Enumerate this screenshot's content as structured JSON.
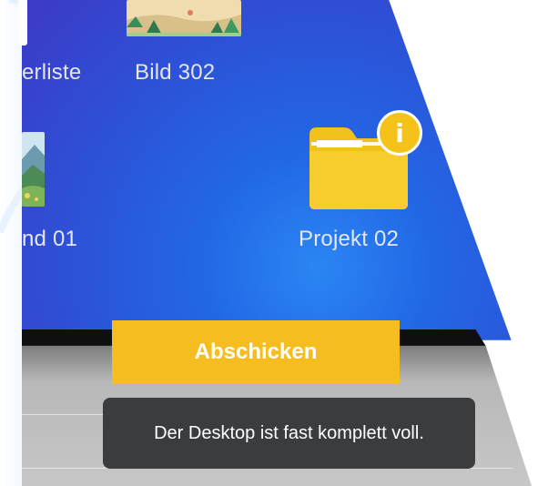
{
  "desktop": {
    "icons": [
      {
        "label": "erliste",
        "kind": "image"
      },
      {
        "label": "Bild 302",
        "kind": "image"
      },
      {
        "label": "nd 01",
        "kind": "image"
      },
      {
        "label": "Projekt 02",
        "kind": "folder",
        "badge": "i"
      }
    ]
  },
  "submit_button": {
    "label": "Abschicken"
  },
  "toast": {
    "message": "Der Desktop ist fast komplett voll."
  },
  "colors": {
    "desktop_blue": "#2268e6",
    "accent_yellow": "#f6bd20",
    "folder_yellow": "#f5c21a",
    "toast_bg": "#3a3c3e"
  }
}
